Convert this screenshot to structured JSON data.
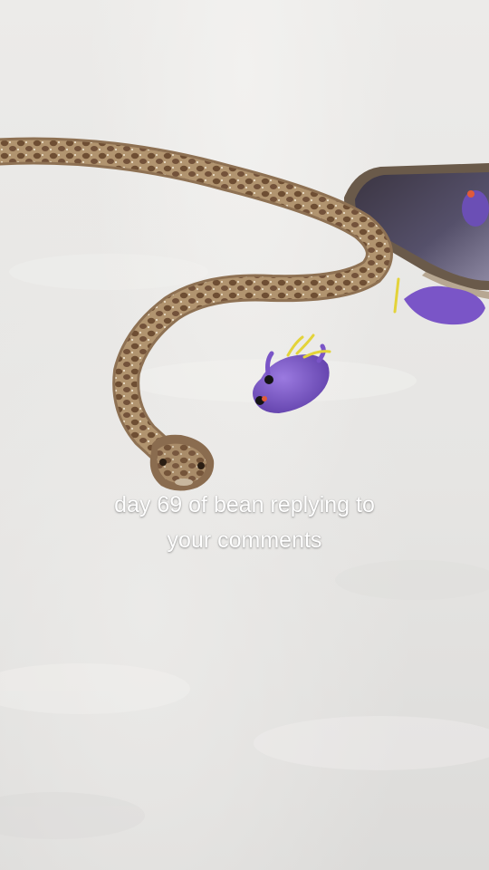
{
  "overlay": {
    "caption_line_1": "day 69 of bean replying to",
    "caption_line_2": "your comments",
    "caption_color": "#ffffff"
  },
  "scene": {
    "subjects": [
      "snake",
      "purple-toy",
      "phone"
    ],
    "colors": {
      "snake_base": "#a98a6a",
      "snake_spots": "#6e4e33",
      "toy_purple": "#7a55c7",
      "toy_antennae": "#e3d33a",
      "background_fur": "#e9e8e6",
      "phone_frame": "#6a5a4a"
    }
  }
}
